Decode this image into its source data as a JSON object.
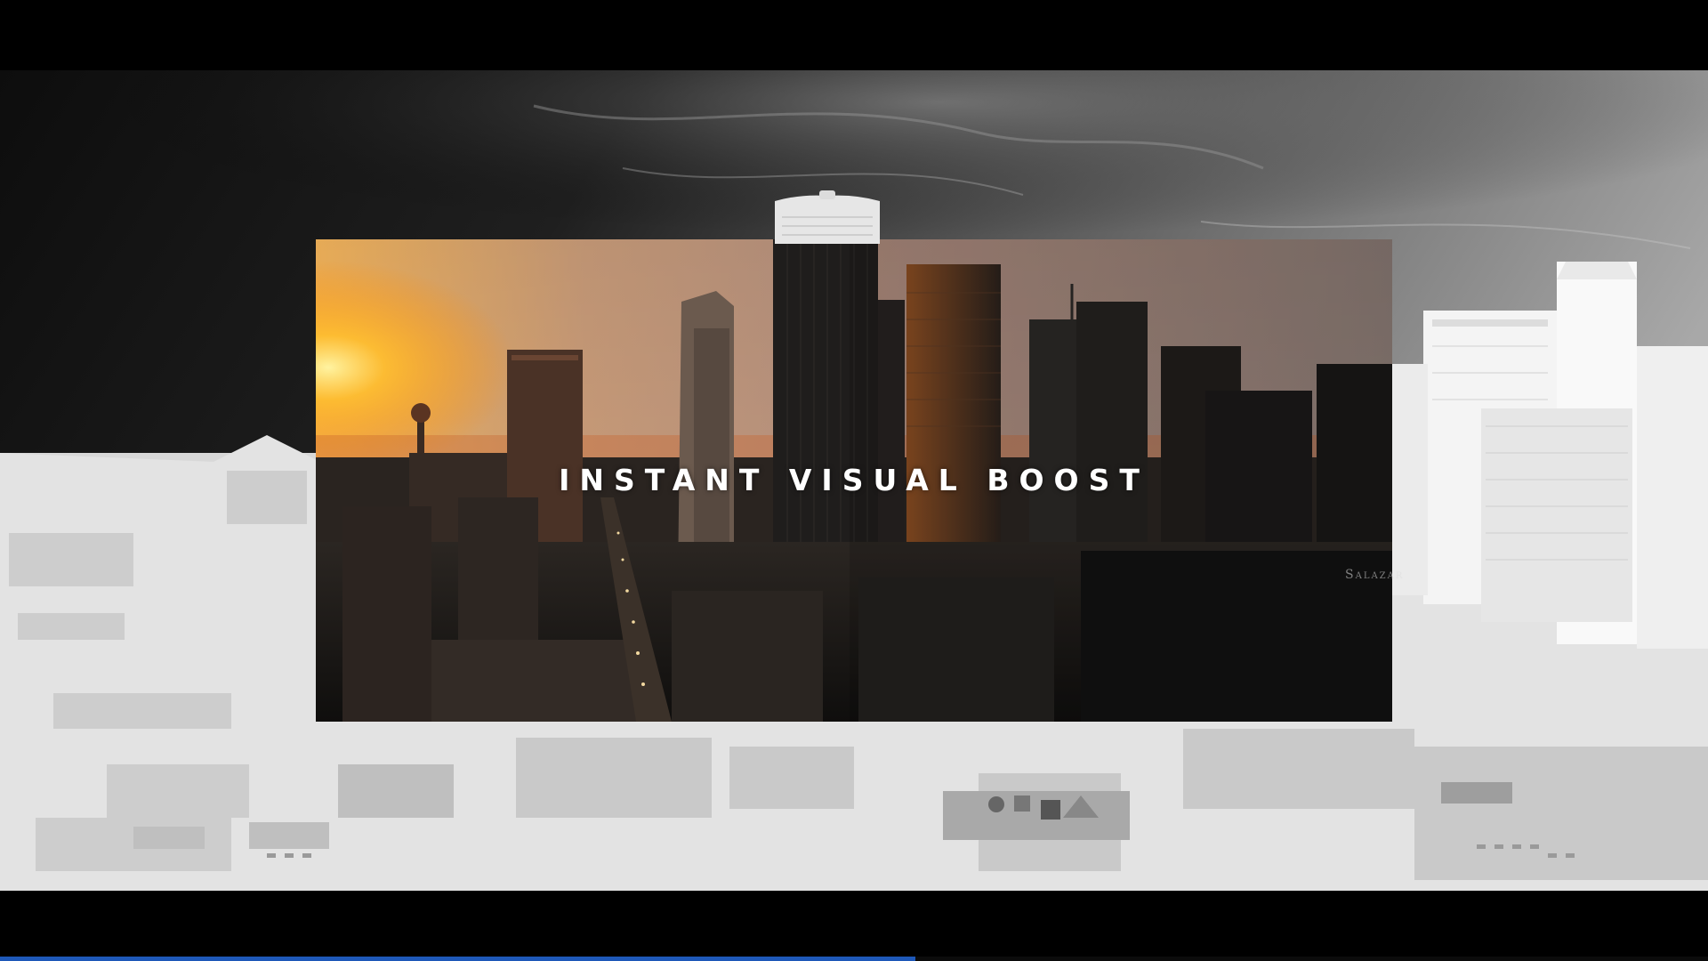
{
  "video": {
    "headline": "INSTANT VISUAL BOOST",
    "watermark": "Salazar",
    "progress_fraction": 0.536
  },
  "colors": {
    "letterbox": "#000000",
    "progress_fill": "#1e58b8",
    "headline_text": "#ffffff"
  }
}
